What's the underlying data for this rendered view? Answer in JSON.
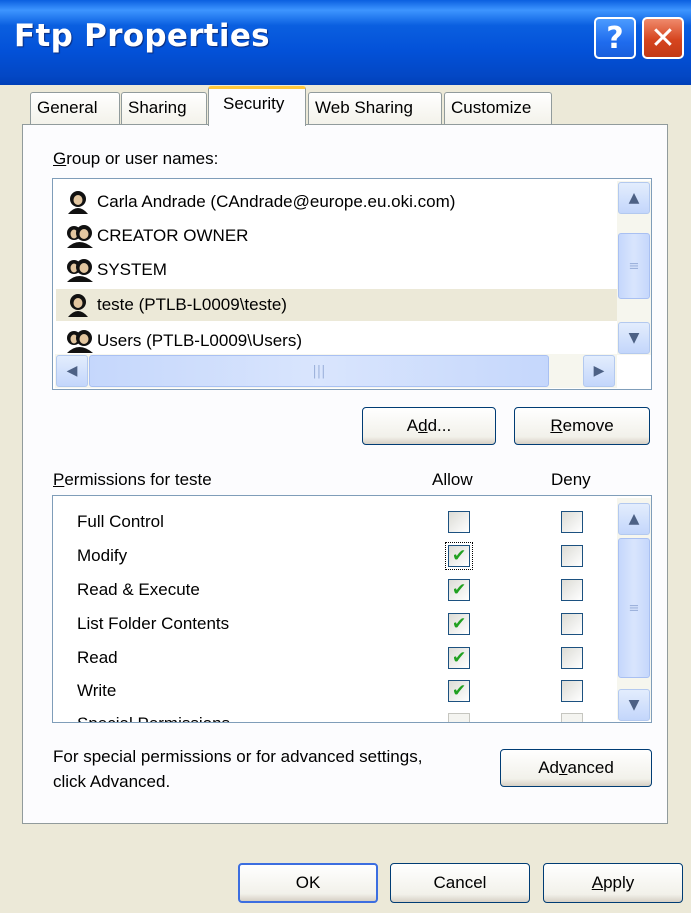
{
  "window": {
    "title": "Ftp Properties",
    "help_glyph": "?",
    "close_glyph": "✕"
  },
  "tabs": [
    {
      "label": "General"
    },
    {
      "label": "Sharing"
    },
    {
      "label": "Security"
    },
    {
      "label": "Web Sharing"
    },
    {
      "label": "Customize"
    }
  ],
  "users": {
    "label_prefix": "G",
    "label_rest": "roup or user names:",
    "items": [
      {
        "name": "Carla Andrade (CAndrade@europe.eu.oki.com)",
        "icon": "user-icon",
        "selected": false
      },
      {
        "name": "CREATOR OWNER",
        "icon": "group-icon",
        "selected": false
      },
      {
        "name": "SYSTEM",
        "icon": "group-icon",
        "selected": false
      },
      {
        "name": "teste (PTLB-L0009\\teste)",
        "icon": "user-icon",
        "selected": true
      },
      {
        "name": "Users (PTLB-L0009\\Users)",
        "icon": "group-icon",
        "selected": false
      }
    ]
  },
  "buttons": {
    "add_pre": "A",
    "add_u": "d",
    "add_post": "d...",
    "remove_u": "R",
    "remove_post": "emove",
    "advanced_pre": "Ad",
    "advanced_u": "v",
    "advanced_post": "anced",
    "ok": "OK",
    "cancel": "Cancel",
    "apply_u": "A",
    "apply_post": "pply"
  },
  "permissions": {
    "header_u": "P",
    "header_rest": "ermissions for teste",
    "allow": "Allow",
    "deny": "Deny",
    "rows": [
      {
        "name": "Full Control",
        "allow": false,
        "deny": false
      },
      {
        "name": "Modify",
        "allow": true,
        "deny": false
      },
      {
        "name": "Read & Execute",
        "allow": true,
        "deny": false
      },
      {
        "name": "List Folder Contents",
        "allow": true,
        "deny": false
      },
      {
        "name": "Read",
        "allow": true,
        "deny": false
      },
      {
        "name": "Write",
        "allow": true,
        "deny": false
      },
      {
        "name": "Special Permissions",
        "allow": false,
        "deny": false
      }
    ]
  },
  "advanced_note": {
    "line1": "For special permissions or for advanced settings,",
    "line2": "click Advanced."
  },
  "colors": {
    "titlebar": "#0a5fe0",
    "tab_active_accent": "#ffc83c",
    "check": "#21a121"
  }
}
